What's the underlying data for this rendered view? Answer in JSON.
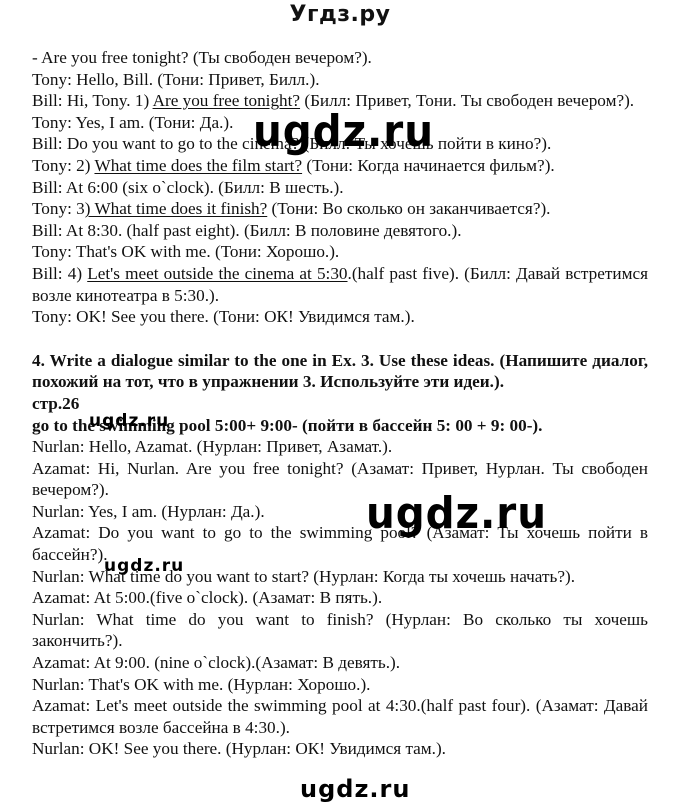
{
  "header": {
    "site_title": "Угдз.ру"
  },
  "watermarks": {
    "wm1": "ugdz.ru",
    "wm2": "ugdz.ru",
    "wm3": "ugdz.ru",
    "wm4": "ugdz.ru",
    "footer": "ugdz.ru"
  },
  "section3": {
    "intro": "- Are you free tonight? (Ты свободен вечером?).",
    "l1": "Tony: Hello, Bill. (Тони: Привет, Билл.).",
    "l2_pre": "Bill: Hi, Tony. 1) ",
    "l2_answer": "Are you free tonight?",
    "l2_post": " (Билл: Привет, Тони. Ты свободен вечером?).",
    "l3": "Tony: Yes, I am. (Тони: Да.).",
    "l4": "Bill: Do you want to go to the cinema? (Билл: Ты хочешь пойти в кино?).",
    "l5_pre": "Tony: 2) ",
    "l5_answer": "What time does the film start?",
    "l5_post": " (Тони: Когда начинается фильм?).",
    "l6": "Bill: At 6:00 (six o`clock). (Билл: В шесть.).",
    "l7_pre": "Tony: 3",
    "l7_answer": ") What time does it finish?",
    "l7_post": " (Тони: Во сколько он заканчивается?).",
    "l8": "Bill: At 8:30. (half past eight). (Билл: В половине девятого.).",
    "l9": "Tony: That's OK with me. (Тони: Хорошо.).",
    "l10_pre": "Bill: 4) ",
    "l10_answer": "Let's meet outside the cinema at 5:30",
    "l10_post": ".(half past five). (Билл: Давай встретимся возле кинотеатра в 5:30.).",
    "l11": "Tony: OK! See you there.  (Тони: ОК! Увидимся там.)."
  },
  "section4": {
    "heading": "4. Write a dialogue similar to the one in Ex. 3. Use these ideas. (Напишите диалог, похожий на тот, что в упражнении 3. Используйте эти идеи.).",
    "page_ref": "стр.26",
    "ideas": "go to the swimming pool 5:00+     9:00- (пойти в бассейн 5: 00 + 9: 00-).",
    "lines": [
      "Nurlan: Hello, Azamat. (Нурлан: Привет, Азамат.).",
      "Azamat: Hi, Nurlan. Are you free tonight? (Азамат: Привет, Нурлан. Ты свободен вечером?).",
      "Nurlan: Yes, I am. (Нурлан: Да.).",
      "Azamat: Do you want to go to the swimming pool? (Азамат: Ты хочешь пойти в бассейн?).",
      "Nurlan: What time do you want to start? (Нурлан: Когда ты хочешь начать?).",
      "Azamat: At 5:00.(five o`clock). (Азамат: В пять.).",
      "Nurlan: What time do you want to finish? (Нурлан: Во сколько ты хочешь закончить?).",
      "Azamat: At 9:00. (nine o`clock).(Азамат: В девять.).",
      "Nurlan: That's OK with me. (Нурлан: Хорошо.).",
      "Azamat: Let's meet outside the swimming pool at 4:30.(half past four). (Азамат: Давай встретимся возле бассейна в 4:30.).",
      "Nurlan: OK! See you there.  (Нурлан: ОК! Увидимся там.)."
    ]
  }
}
